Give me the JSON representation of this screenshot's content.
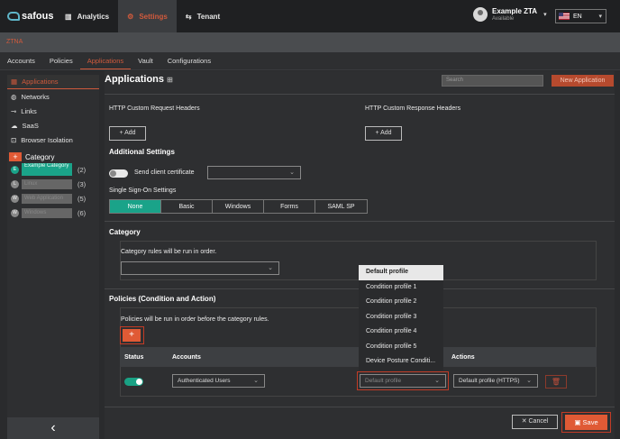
{
  "brand": {
    "logo_text": "safous",
    "accent": "#d05a3c",
    "green": "#1aa389"
  },
  "topnav": [
    {
      "label": "Analytics",
      "icon": "analytics-icon"
    },
    {
      "label": "Settings",
      "icon": "gear-icon",
      "active": true
    },
    {
      "label": "Tenant",
      "icon": "tenant-icon"
    }
  ],
  "user": {
    "name": "Example ZTA",
    "status": "Available",
    "lang": "EN"
  },
  "breadcrumb": "ZTNA",
  "subnav": [
    {
      "label": "Accounts"
    },
    {
      "label": "Policies"
    },
    {
      "label": "Applications",
      "active": true
    },
    {
      "label": "Vault"
    },
    {
      "label": "Configurations"
    }
  ],
  "sidebar": {
    "items": [
      {
        "label": "Applications",
        "active": true
      },
      {
        "label": "Networks"
      },
      {
        "label": "Links"
      },
      {
        "label": "SaaS"
      },
      {
        "label": "Browser Isolation"
      }
    ],
    "category_label": "Category",
    "categories": [
      {
        "letter": "E",
        "name": "Example Category",
        "count": "(2)",
        "active": true
      },
      {
        "letter": "L",
        "name": "Linux",
        "count": "(3)"
      },
      {
        "letter": "W",
        "name": "Web Application",
        "count": "(5)"
      },
      {
        "letter": "W",
        "name": "Windows",
        "count": "(6)"
      }
    ],
    "collapse_icon": "‹"
  },
  "main": {
    "title": "Applications",
    "search_placeholder": "Search",
    "new_app": "New Application",
    "req_headers": "HTTP Custom Request Headers",
    "resp_headers": "HTTP Custom Response Headers",
    "add": "Add",
    "additional": "Additional Settings",
    "send_cert": "Send client certificate",
    "sso": "Single Sign-On Settings",
    "sso_options": [
      "None",
      "Basic",
      "Windows",
      "Forms",
      "SAML SP"
    ],
    "category_title": "Category",
    "category_desc": "Category rules will be run in order.",
    "policies_title": "Policies (Condition and Action)",
    "policies_desc": "Policies will be run in order before the category rules.",
    "table_headers": [
      "Status",
      "Accounts",
      "Actions"
    ],
    "row": {
      "accounts": "Authenticated Users",
      "condition": "Default profile",
      "action": "Default profile (HTTPS)"
    },
    "menu": [
      "Default profile",
      "Condition profile 1",
      "Condition profile 2",
      "Condition profile 3",
      "Condition profile 4",
      "Condition profile 5",
      "Device Posture Conditi..."
    ],
    "cancel": "Cancel",
    "save": "Save"
  }
}
